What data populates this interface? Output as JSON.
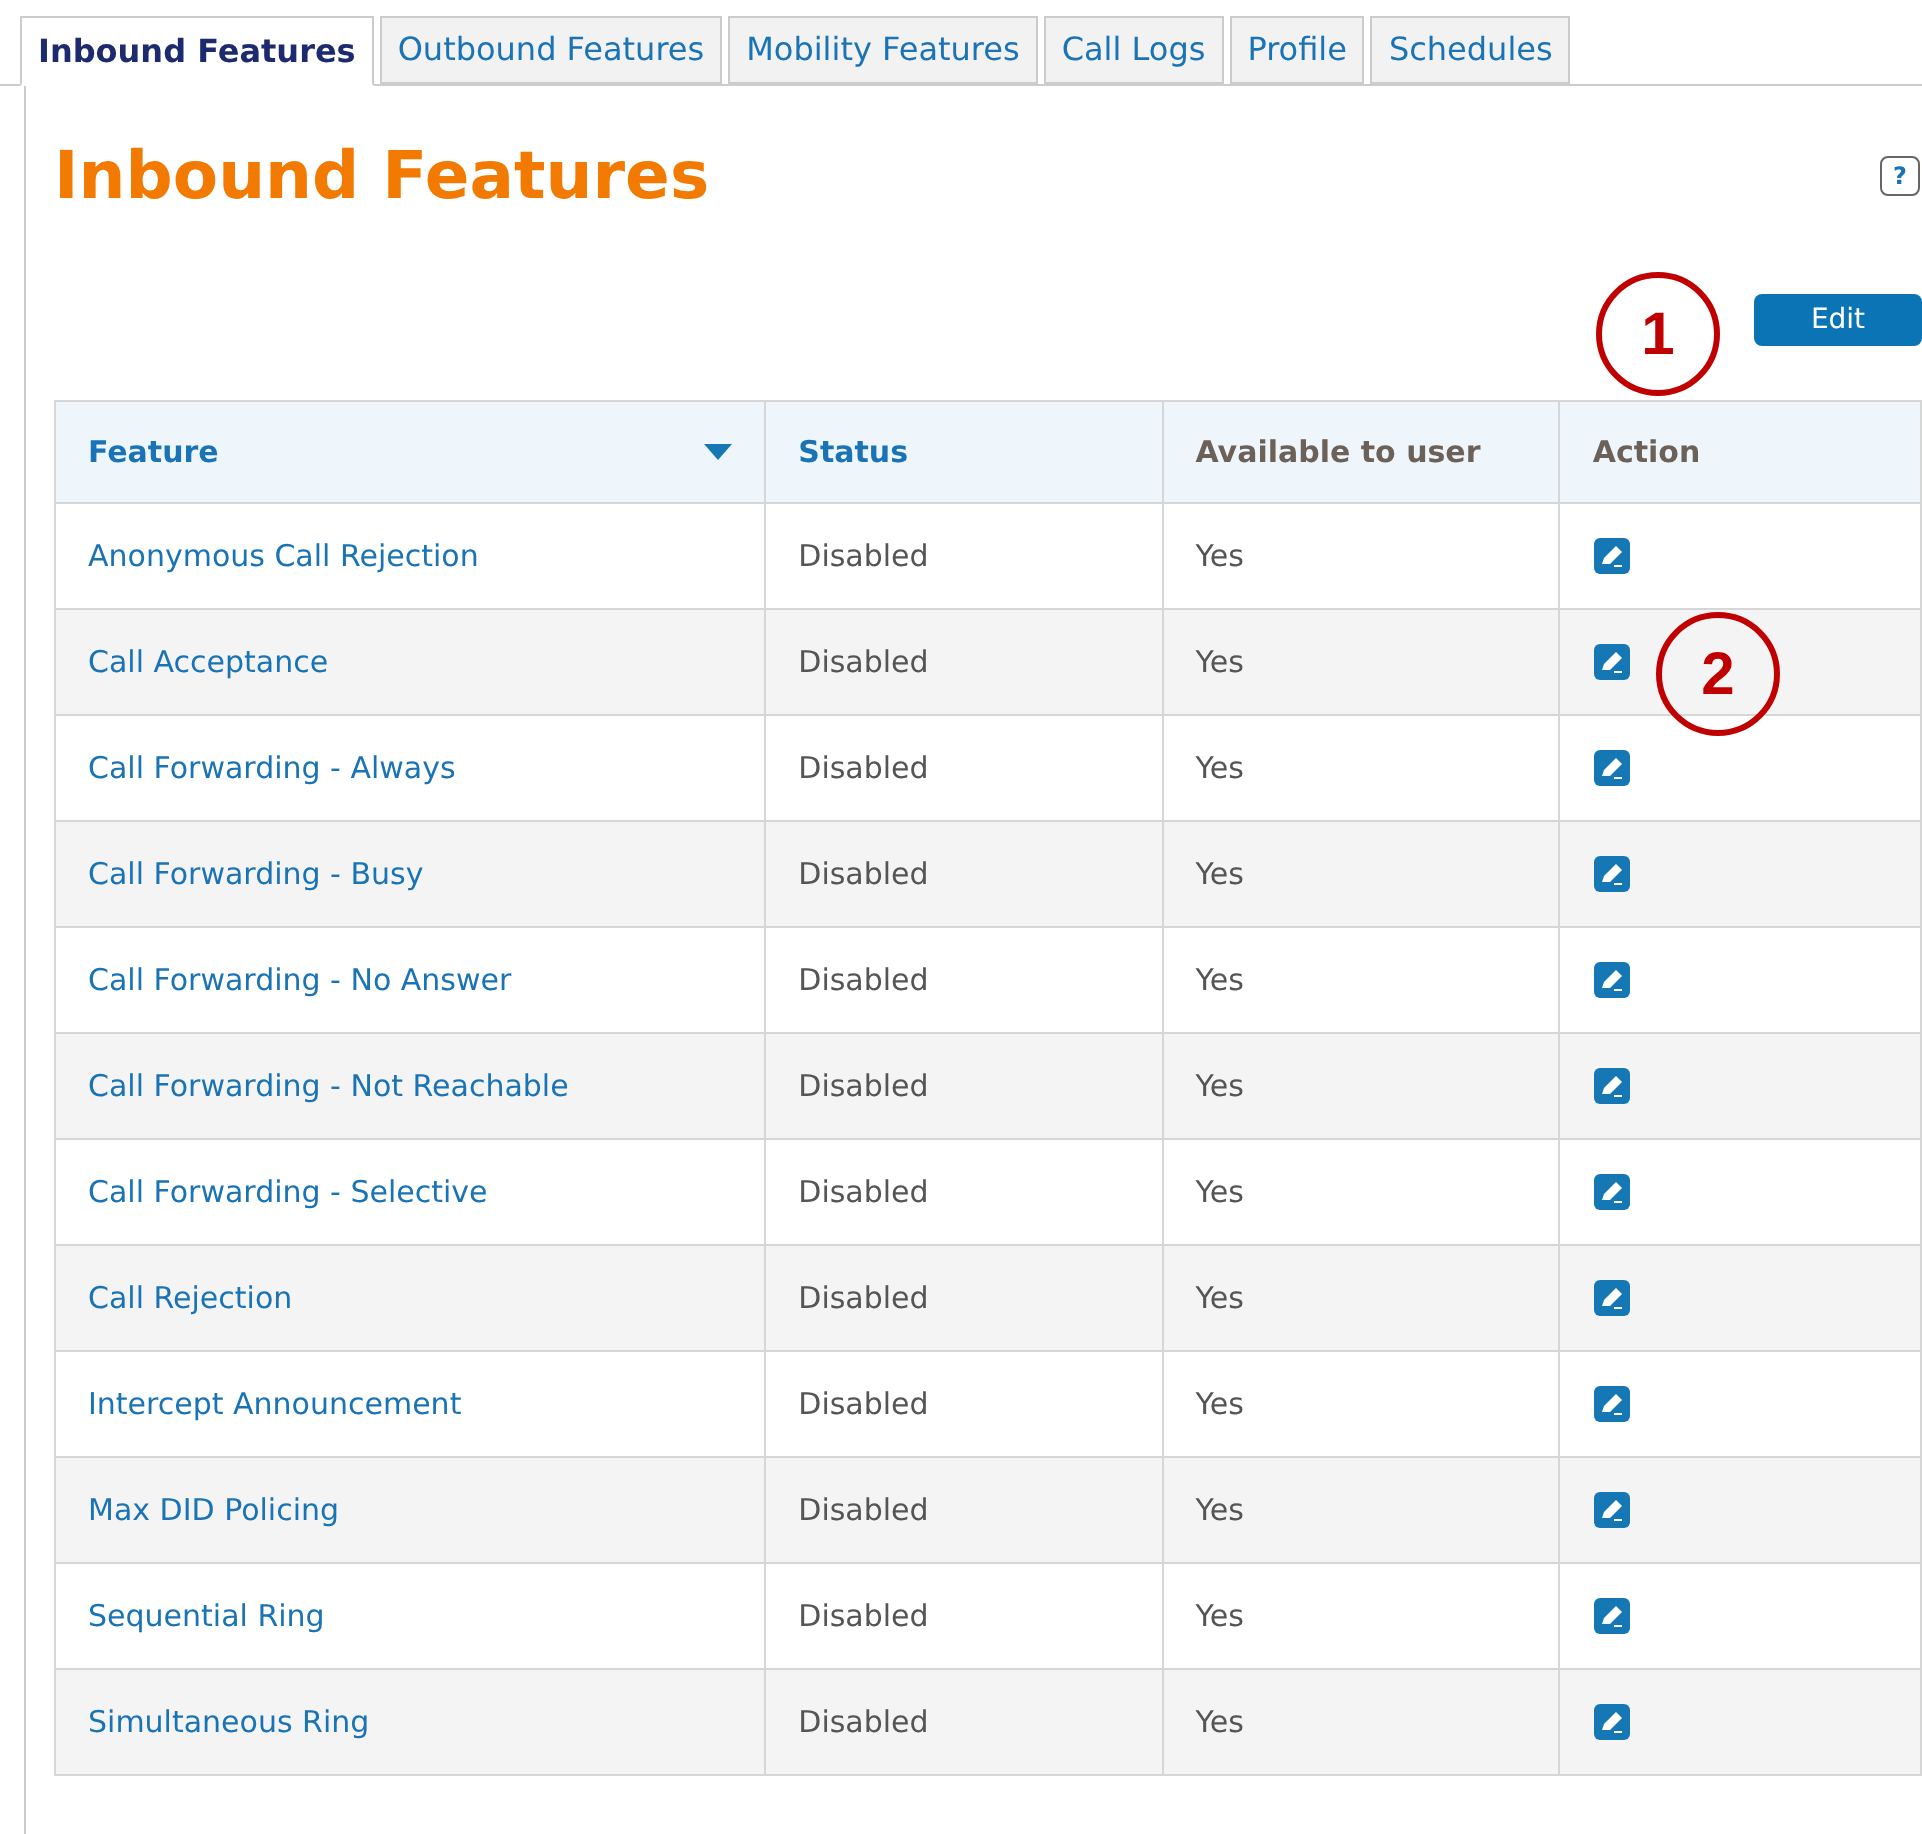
{
  "tabs": [
    {
      "label": "Inbound Features",
      "selected": true
    },
    {
      "label": "Outbound Features",
      "selected": false
    },
    {
      "label": "Mobility Features",
      "selected": false
    },
    {
      "label": "Call Logs",
      "selected": false
    },
    {
      "label": "Profile",
      "selected": false
    },
    {
      "label": "Schedules",
      "selected": false
    }
  ],
  "heading": "Inbound Features",
  "help_button": "?",
  "edit_button": "Edit",
  "callouts": [
    "1",
    "2"
  ],
  "table": {
    "columns": [
      {
        "label": "Feature",
        "sortable": true,
        "sorted": true
      },
      {
        "label": "Status",
        "sortable": true,
        "sorted": false
      },
      {
        "label": "Available to user",
        "sortable": false,
        "sorted": false
      },
      {
        "label": "Action",
        "sortable": false,
        "sorted": false
      }
    ],
    "rows": [
      {
        "feature": "Anonymous Call Rejection",
        "status": "Disabled",
        "available": "Yes"
      },
      {
        "feature": "Call Acceptance",
        "status": "Disabled",
        "available": "Yes"
      },
      {
        "feature": "Call Forwarding - Always",
        "status": "Disabled",
        "available": "Yes"
      },
      {
        "feature": "Call Forwarding - Busy",
        "status": "Disabled",
        "available": "Yes"
      },
      {
        "feature": "Call Forwarding - No Answer",
        "status": "Disabled",
        "available": "Yes"
      },
      {
        "feature": "Call Forwarding - Not Reachable",
        "status": "Disabled",
        "available": "Yes"
      },
      {
        "feature": "Call Forwarding - Selective",
        "status": "Disabled",
        "available": "Yes"
      },
      {
        "feature": "Call Rejection",
        "status": "Disabled",
        "available": "Yes"
      },
      {
        "feature": "Intercept Announcement",
        "status": "Disabled",
        "available": "Yes"
      },
      {
        "feature": "Max DID Policing",
        "status": "Disabled",
        "available": "Yes"
      },
      {
        "feature": "Sequential Ring",
        "status": "Disabled",
        "available": "Yes"
      },
      {
        "feature": "Simultaneous Ring",
        "status": "Disabled",
        "available": "Yes"
      }
    ]
  }
}
